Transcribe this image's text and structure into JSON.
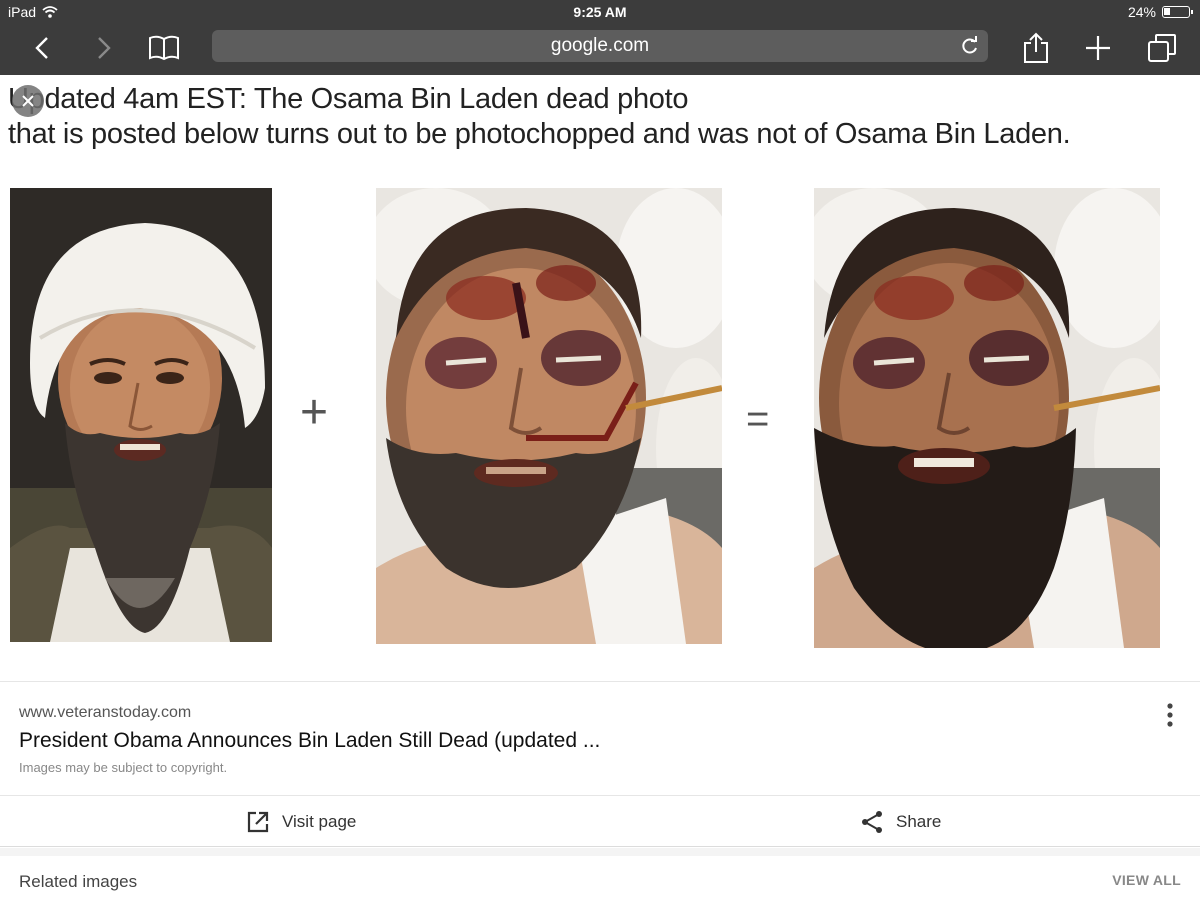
{
  "status_bar": {
    "device": "iPad",
    "time": "9:25 AM",
    "battery_text": "24%",
    "battery_level": 0.24
  },
  "browser": {
    "url": "google.com",
    "icons": [
      "back-icon",
      "forward-icon",
      "bookmarks-icon",
      "reload-icon",
      "share-icon",
      "new-tab-icon",
      "tabs-icon"
    ]
  },
  "image": {
    "caption_line1": "Updated 4am EST: The Osama Bin Laden dead photo",
    "caption_line2": "that is posted below turns out to be photochopped and was not of Osama Bin Laden.",
    "plus_sign": "+",
    "equals_sign": "="
  },
  "result": {
    "site": "www.veteranstoday.com",
    "title": "President Obama Announces Bin Laden Still Dead (updated ...",
    "copyright": "Images may be subject to copyright."
  },
  "actions": {
    "visit_label": "Visit page",
    "share_label": "Share"
  },
  "related": {
    "title": "Related images",
    "view_all": "VIEW ALL"
  },
  "colors": {
    "toolbar": "#3c3c3c",
    "urlbar": "#5d5d5d"
  }
}
